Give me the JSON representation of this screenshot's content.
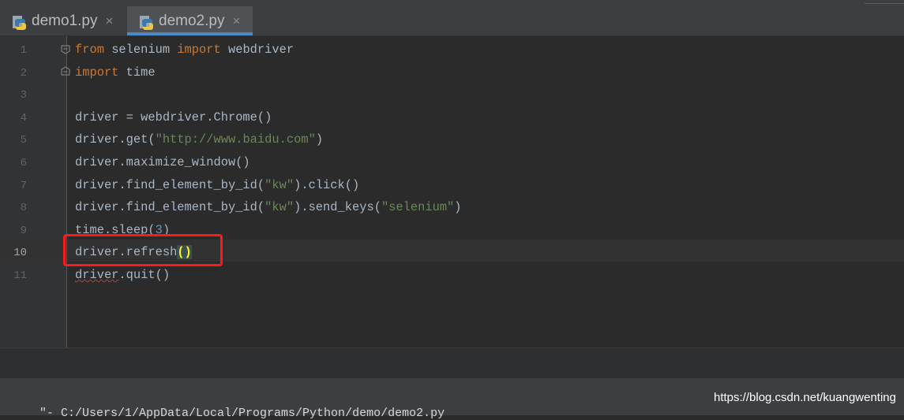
{
  "tabs": [
    {
      "label": "demo1.py",
      "close": "×",
      "active": false
    },
    {
      "label": "demo2.py",
      "close": "×",
      "active": true
    }
  ],
  "editor": {
    "current_line": 10,
    "line_numbers": [
      "1",
      "2",
      "3",
      "4",
      "5",
      "6",
      "7",
      "8",
      "9",
      "10",
      "11"
    ],
    "lines": [
      [
        {
          "t": "from",
          "c": "kw"
        },
        {
          "t": " selenium "
        },
        {
          "t": "import",
          "c": "kw"
        },
        {
          "t": " webdriver"
        }
      ],
      [
        {
          "t": "import",
          "c": "kw"
        },
        {
          "t": " time"
        }
      ],
      [],
      [
        {
          "t": "driver = webdriver.Chrome()"
        }
      ],
      [
        {
          "t": "driver.get("
        },
        {
          "t": "\"http://www.baidu.com\"",
          "c": "str"
        },
        {
          "t": ")"
        }
      ],
      [
        {
          "t": "driver.maximize_window()"
        }
      ],
      [
        {
          "t": "driver.find_element_by_id("
        },
        {
          "t": "\"kw\"",
          "c": "str"
        },
        {
          "t": ").click()"
        }
      ],
      [
        {
          "t": "driver.find_element_by_id("
        },
        {
          "t": "\"kw\"",
          "c": "str"
        },
        {
          "t": ").send_keys("
        },
        {
          "t": "\"selenium\"",
          "c": "str"
        },
        {
          "t": ")"
        }
      ],
      [
        {
          "t": "time.sleep("
        },
        {
          "t": "3",
          "c": "num"
        },
        {
          "t": ")"
        }
      ],
      [
        {
          "t": "driver.refresh"
        },
        {
          "t": "()",
          "c": "brk"
        }
      ],
      [
        {
          "t": "driver",
          "c": "squig"
        },
        {
          "t": ".quit()"
        }
      ]
    ]
  },
  "status": {
    "path_fragment": "\"- C:/Users/1/AppData/Local/Programs/Python/demo/demo2.py"
  },
  "watermark": "https://blog.csdn.net/kuangwenting",
  "colors": {
    "keyword": "#cc7832",
    "string": "#6a8759",
    "number": "#6897bb",
    "text": "#a9b7c6",
    "highlight_box": "#ff1a1a",
    "active_tab_underline": "#4a88c7"
  }
}
